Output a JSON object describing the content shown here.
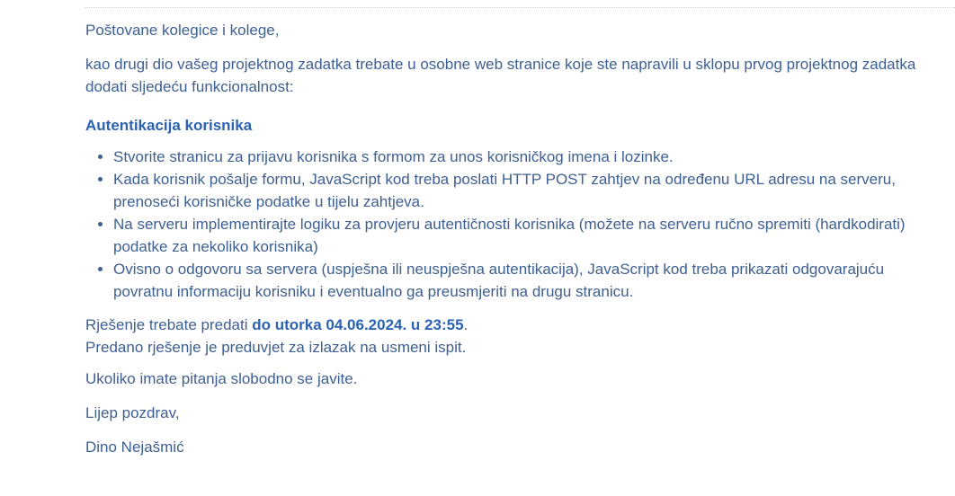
{
  "message": {
    "greeting": "Poštovane kolegice i kolege,",
    "intro": "kao drugi dio vašeg projektnog zadatka trebate u osobne web stranice koje ste napravili u sklopu prvog projektnog zadatka dodati sljedeću funkcionalnost:",
    "section_heading": "Autentikacija korisnika",
    "tasks": [
      "Stvorite stranicu za prijavu korisnika s formom za unos korisničkog imena i lozinke.",
      "Kada korisnik pošalje formu, JavaScript kod treba poslati HTTP POST zahtjev na određenu URL adresu na serveru, prenoseći korisničke podatke u tijelu zahtjeva.",
      "Na serveru implementirajte logiku za provjeru autentičnosti korisnika (možete na serveru ručno spremiti (hardkodirati) podatke za nekoliko korisnika)",
      "Ovisno o odgovoru sa servera (uspješna ili neuspješna autentikacija), JavaScript kod treba prikazati odgovarajuću povratnu informaciju korisniku i eventualno ga preusmjeriti na drugu stranicu."
    ],
    "deadline_prefix": "Rješenje trebate predati ",
    "deadline_value": "do utorka 04.06.2024. u 23:55",
    "deadline_suffix": ".",
    "prerequisite": "Predano rješenje je preduvjet za izlazak na usmeni ispit.",
    "questions": "Ukoliko imate pitanja slobodno se javite.",
    "closing": "Lijep pozdrav,",
    "signature": "Dino Nejašmić"
  }
}
